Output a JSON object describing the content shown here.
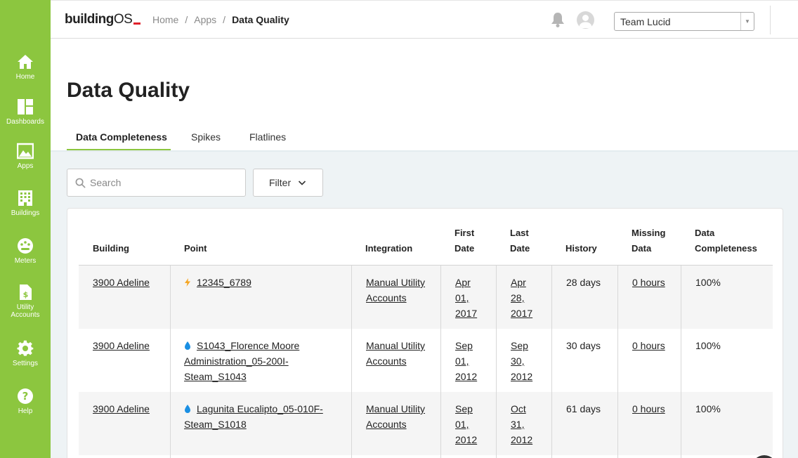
{
  "sidebar": {
    "items": [
      {
        "label": "Home",
        "icon": "home-icon"
      },
      {
        "label": "Dashboards",
        "icon": "dashboard-icon"
      },
      {
        "label": "Apps",
        "icon": "apps-icon"
      },
      {
        "label": "Buildings",
        "icon": "building-icon"
      },
      {
        "label": "Meters",
        "icon": "meter-icon"
      },
      {
        "label": "Utility Accounts",
        "icon": "utility-bill-icon"
      },
      {
        "label": "Settings",
        "icon": "gear-icon"
      },
      {
        "label": "Help",
        "icon": "help-icon"
      }
    ]
  },
  "topbar": {
    "logo_bold": "building",
    "logo_rest": "OS",
    "breadcrumb": [
      "Home",
      "Apps",
      "Data Quality"
    ],
    "breadcrumb_sep": "/",
    "team": "Team Lucid"
  },
  "header": {
    "title": "Data Quality",
    "tabs": [
      "Data Completeness",
      "Spikes",
      "Flatlines"
    ]
  },
  "toolbar": {
    "search_placeholder": "Search",
    "filter_label": "Filter"
  },
  "table": {
    "columns": [
      "Building",
      "Point",
      "Integration",
      "First Date",
      "Last Date",
      "History",
      "Missing Data",
      "Data Completeness"
    ],
    "rows": [
      {
        "building": "3900 Adeline",
        "point_icon": "electricity-icon",
        "point": "12345_6789",
        "integration": "Manual Utility Accounts",
        "first_date": "Apr 01, 2017",
        "last_date": "Apr 28, 2017",
        "history": "28 days",
        "missing": "0 hours",
        "completeness": "100%"
      },
      {
        "building": "3900 Adeline",
        "point_icon": "water-drop-icon",
        "point": "S1043_Florence Moore Administration_05-200I-Steam_S1043",
        "integration": "Manual Utility Accounts",
        "first_date": "Sep 01, 2012",
        "last_date": "Sep 30, 2012",
        "history": "30 days",
        "missing": "0 hours",
        "completeness": "100%"
      },
      {
        "building": "3900 Adeline",
        "point_icon": "water-drop-icon",
        "point": "Lagunita Eucalipto_05-010F-Steam_S1018",
        "integration": "Manual Utility Accounts",
        "first_date": "Sep 01, 2012",
        "last_date": "Oct 31, 2012",
        "history": "61 days",
        "missing": "0 hours",
        "completeness": "100%"
      }
    ]
  },
  "colors": {
    "brand_green": "#8cc63f",
    "electric": "#f5a623",
    "water": "#1a8fe3",
    "logo_accent": "#e0202a"
  }
}
